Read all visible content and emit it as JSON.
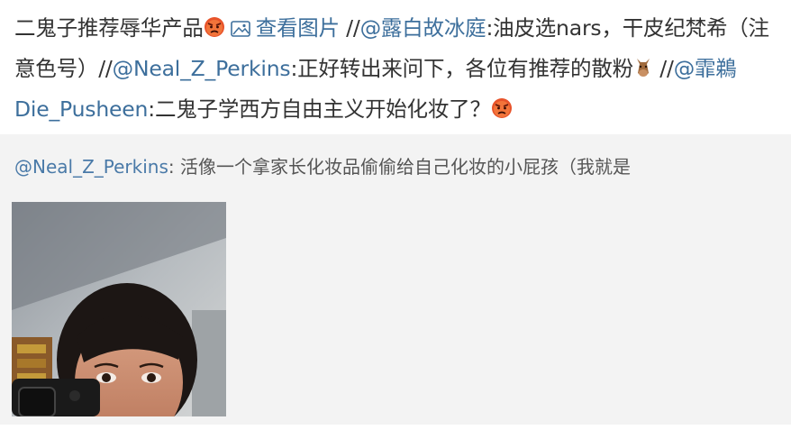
{
  "post": {
    "text1": "二鬼子推荐辱华产品",
    "view_image_label": "查看图片",
    "sep1": " //",
    "mention1": "@露白故冰庭",
    "text2": ":油皮选nars，干皮纪梵希（注意色号）//",
    "mention2": "@Neal_Z_Perkins",
    "text3": ":正好转出来问下，各位有推荐的散粉",
    "sep3": " //",
    "mention3": "@霏鵜Die_Pusheen",
    "text4": ":二鬼子学西方自由主义开始化妆了？",
    "emoji_angry": "angry-face-icon",
    "emoji_horse": "horse-face-icon"
  },
  "repost": {
    "mention": "@Neal_Z_Perkins",
    "text": ": 活像一个拿家长化妆品偷偷给自己化妆的小屁孩（我就是"
  },
  "colors": {
    "link": "#3d6f9c",
    "repost_bg": "#f3f3f3"
  }
}
